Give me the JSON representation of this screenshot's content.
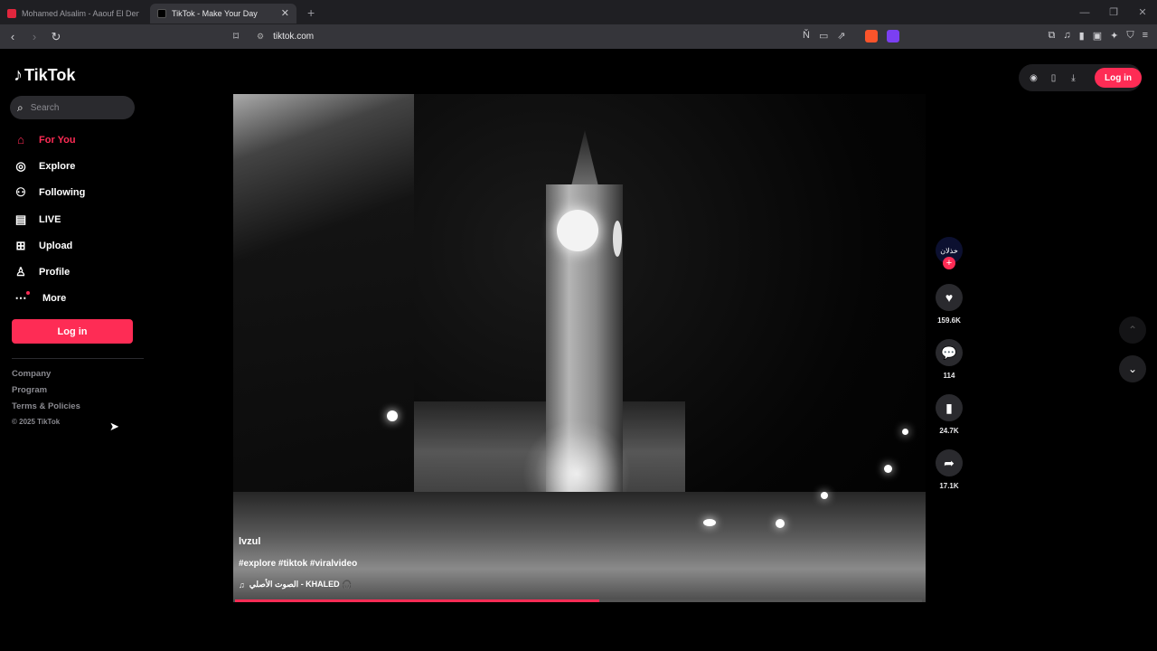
{
  "browser": {
    "tabs": [
      {
        "title": "Mohamed Alsalim - Aaouf El Denia (",
        "favicon": "youtube-icon"
      },
      {
        "title": "TikTok - Make Your Day",
        "favicon": "tiktok-icon"
      }
    ],
    "url": "tiktok.com"
  },
  "sidebar": {
    "logo": "TikTok",
    "search_placeholder": "Search",
    "items": [
      {
        "label": "For You",
        "icon": "home-icon",
        "active": true
      },
      {
        "label": "Explore",
        "icon": "compass-icon"
      },
      {
        "label": "Following",
        "icon": "following-icon"
      },
      {
        "label": "LIVE",
        "icon": "live-icon"
      },
      {
        "label": "Upload",
        "icon": "upload-icon"
      },
      {
        "label": "Profile",
        "icon": "profile-icon"
      },
      {
        "label": "More",
        "icon": "more-icon"
      }
    ],
    "login_label": "Log in",
    "footer": [
      "Company",
      "Program",
      "Terms & Policies"
    ],
    "copyright": "© 2025 TikTok"
  },
  "header": {
    "login_label": "Log in"
  },
  "video": {
    "username": "lvzul",
    "tags": "#explore #tiktok #viralvideo",
    "sound": "الصوت الأصلي - KHALED 🎧",
    "progress_fraction": 0.53
  },
  "actions": {
    "avatar_text": "خذلان",
    "likes": "159.6K",
    "comments": "114",
    "saves": "24.7K",
    "shares": "17.1K"
  },
  "colors": {
    "accent": "#fe2c55",
    "background": "#000000"
  }
}
